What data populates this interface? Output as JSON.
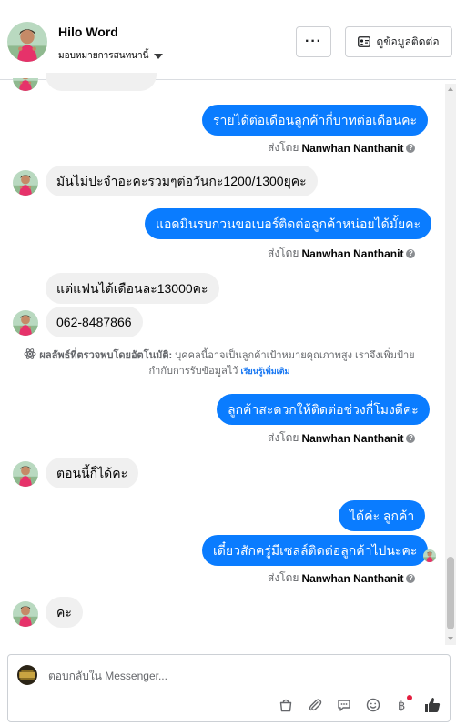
{
  "header": {
    "name": "Hilo Word",
    "assign_label": "มอบหมายการสนทนานี้",
    "more_label": "···",
    "contact_label": "ดูข้อมูลติดต่อ"
  },
  "messages": [
    {
      "id": "m1",
      "dir": "out",
      "text": "รายได้ต่อเดือนลูกค้ากี่บาทต่อเดือนคะ"
    },
    {
      "id": "m2",
      "dir": "in",
      "text": "มันไม่ปะจำอะคะรวมๆต่อวันกะ1200/1300ยุคะ"
    },
    {
      "id": "m3",
      "dir": "out",
      "text": "แอดมินรบกวนขอเบอร์ติดต่อลูกค้าหน่อยได้มั้ยคะ"
    },
    {
      "id": "m4",
      "dir": "in",
      "text": "แต่แฟนได้เดือนละ13000คะ"
    },
    {
      "id": "m5",
      "dir": "in",
      "text": "062-8487866"
    },
    {
      "id": "m6",
      "dir": "out",
      "text": "ลูกค้าสะดวกให้ติดต่อช่วงกี่โมงดีคะ"
    },
    {
      "id": "m7",
      "dir": "in",
      "text": "ตอนนี้ก็ได้คะ"
    },
    {
      "id": "m8",
      "dir": "out",
      "text": "ได้ค่ะ ลูกค้า"
    },
    {
      "id": "m9",
      "dir": "out",
      "text": "เดี๋ยวสักครู่มีเซลล์ติดต่อลูกค้าไปนะคะ"
    },
    {
      "id": "m10",
      "dir": "in",
      "text": "คะ"
    }
  ],
  "sent_by": {
    "prefix": "ส่งโดย",
    "sender": "Nanwhan Nanthanit",
    "help_icon": "?"
  },
  "ai_note": {
    "label": "ผลลัพธ์ที่ตรวจพบโดยอัตโนมัติ:",
    "text": "บุคคลนี้อาจเป็นลูกค้าเป้าหมายคุณภาพสูง เราจึงเพิ่มป้ายกำกับการรับข้อมูลไว้",
    "link": "เรียนรู้เพิ่มเติม"
  },
  "composer": {
    "placeholder": "ตอบกลับใน Messenger...",
    "tools": [
      "shopping-bag-icon",
      "attachment-icon",
      "saved-replies-icon",
      "emoji-icon",
      "baht-payment-icon",
      "like-icon"
    ]
  },
  "colors": {
    "outgoing_bubble": "#0a7cff",
    "incoming_bubble": "#f0f0f0",
    "link": "#1877f2",
    "notification_dot": "#e41e3f"
  }
}
